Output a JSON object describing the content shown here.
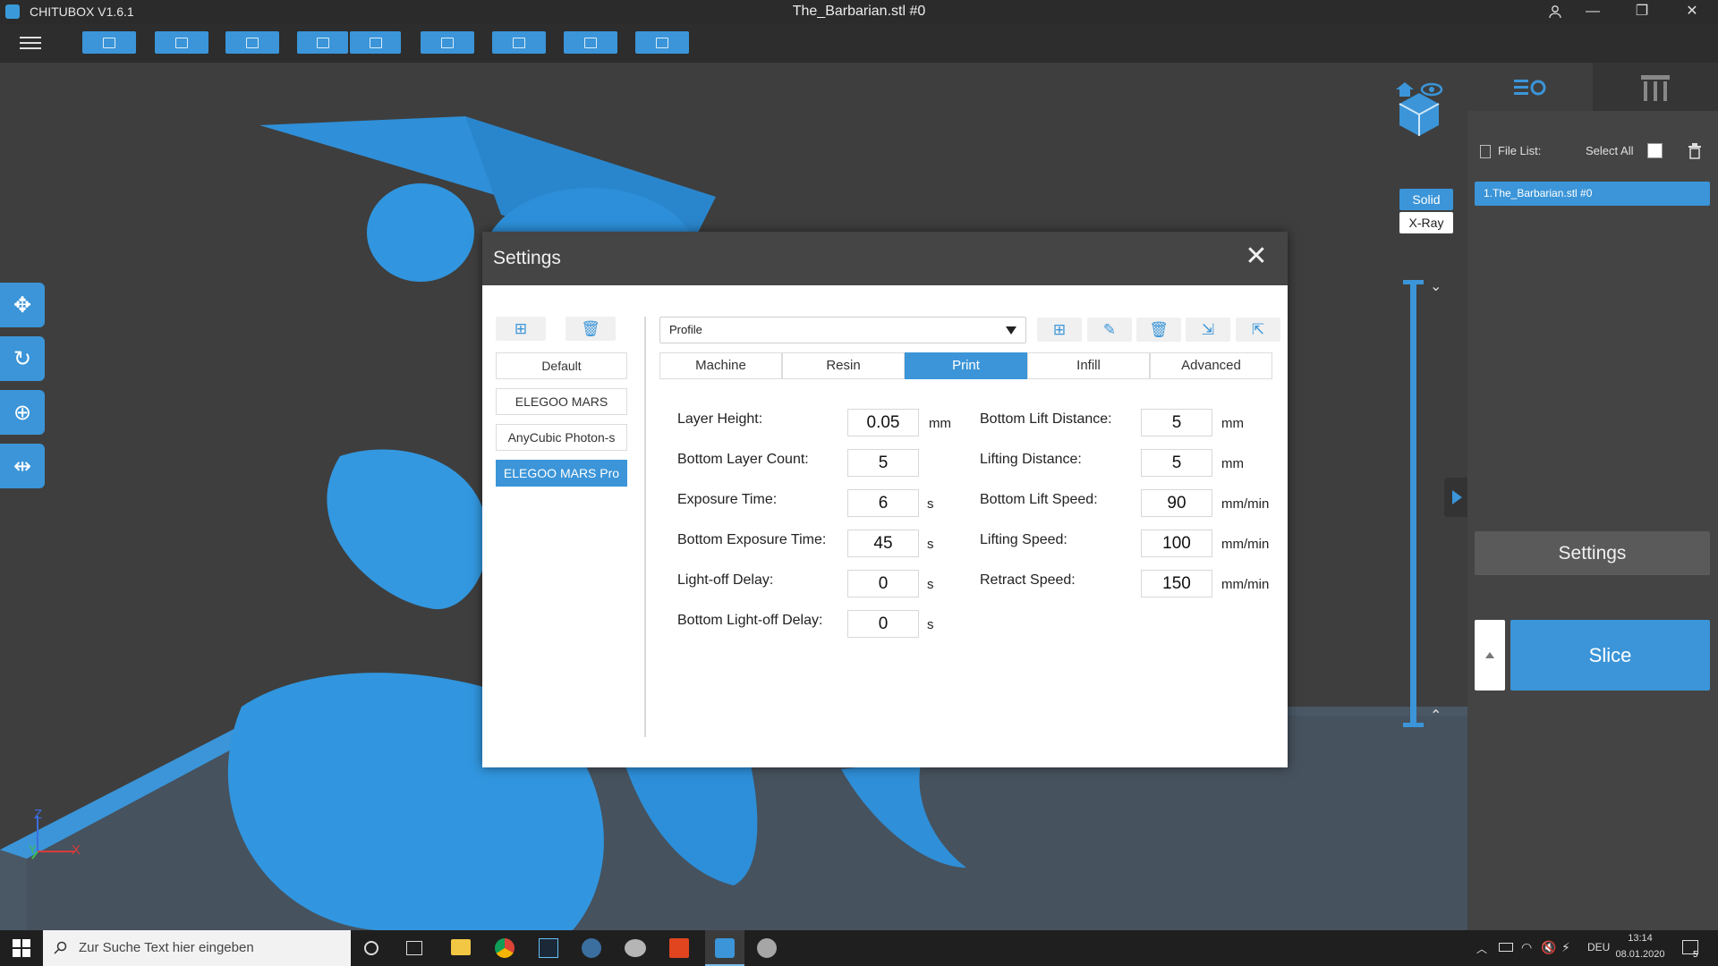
{
  "app": {
    "name": "CHITUBOX V1.6.1",
    "document": "The_Barbarian.stl #0",
    "accent": "#3b95d8"
  },
  "window_controls": {
    "user": "user-icon",
    "minimize": "—",
    "restore": "❐",
    "close": "✕"
  },
  "toolbar": {
    "icons": [
      "open-file-icon",
      "save-icon",
      "select-icon",
      "undo-icon",
      "redo-icon",
      "file-list-icon",
      "supports-icon",
      "hollow-icon",
      "slice-preview-icon"
    ]
  },
  "view_modes": {
    "solid": "Solid",
    "xray": "X-Ray"
  },
  "right_panel": {
    "file_list_label": "File List:",
    "select_all_label": "Select All",
    "files": [
      "1.The_Barbarian.stl #0"
    ],
    "settings_button": "Settings",
    "slice_button": "Slice"
  },
  "settings_dialog": {
    "title": "Settings",
    "profiles": [
      "Default",
      "ELEGOO MARS",
      "AnyCubic Photon-s",
      "ELEGOO MARS Pro"
    ],
    "active_profile": "ELEGOO MARS Pro",
    "profile_select": "Profile",
    "tabs": [
      "Machine",
      "Resin",
      "Print",
      "Infill",
      "Advanced"
    ],
    "active_tab": "Print",
    "left_fields": [
      {
        "label": "Layer Height:",
        "value": "0.05",
        "unit": "mm"
      },
      {
        "label": "Bottom Layer Count:",
        "value": "5",
        "unit": ""
      },
      {
        "label": "Exposure Time:",
        "value": "6",
        "unit": "s"
      },
      {
        "label": "Bottom Exposure Time:",
        "value": "45",
        "unit": "s"
      },
      {
        "label": "Light-off Delay:",
        "value": "0",
        "unit": "s"
      },
      {
        "label": "Bottom Light-off Delay:",
        "value": "0",
        "unit": "s"
      }
    ],
    "right_fields": [
      {
        "label": "Bottom Lift Distance:",
        "value": "5",
        "unit": "mm"
      },
      {
        "label": "Lifting Distance:",
        "value": "5",
        "unit": "mm"
      },
      {
        "label": "Bottom Lift Speed:",
        "value": "90",
        "unit": "mm/min"
      },
      {
        "label": "Lifting Speed:",
        "value": "100",
        "unit": "mm/min"
      },
      {
        "label": "Retract Speed:",
        "value": "150",
        "unit": "mm/min"
      }
    ]
  },
  "axes": {
    "z": "Z",
    "y": "Y",
    "x": "X"
  },
  "taskbar": {
    "search_placeholder": "Zur Suche Text hier eingeben",
    "language": "DEU",
    "time": "13:14",
    "date": "08.01.2020",
    "notifications": "5"
  }
}
